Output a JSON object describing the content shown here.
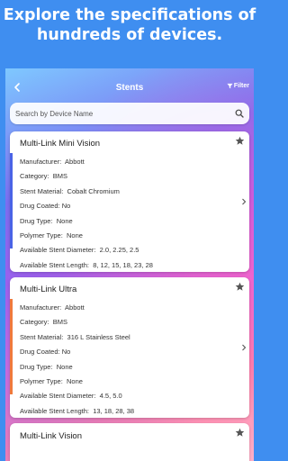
{
  "headline": "Explore the specifications of hundreds of devices.",
  "appbar": {
    "title": "Stents",
    "filter_label": "Filter"
  },
  "search": {
    "placeholder": "Search by Device Name"
  },
  "colors": {
    "background": "#3f8ef0",
    "accent_blue": "#4a63e6",
    "accent_orange": "#f07a3c"
  },
  "devices": [
    {
      "name": "Multi-Link Mini Vision",
      "fields": [
        {
          "label": "Manufacturer:",
          "value": "Abbott"
        },
        {
          "label": "Category:",
          "value": "BMS"
        },
        {
          "label": "Stent Material:",
          "value": "Cobalt Chromium"
        },
        {
          "label": "Drug Coated:",
          "value": "No"
        },
        {
          "label": "Drug Type:",
          "value": "None"
        },
        {
          "label": "Polymer Type:",
          "value": "None"
        },
        {
          "label": "Available Stent Diameter:",
          "value": "2.0, 2.25, 2.5"
        },
        {
          "label": "Available Stent Length:",
          "value": "8, 12, 15, 18, 23, 28"
        }
      ]
    },
    {
      "name": "Multi-Link Ultra",
      "fields": [
        {
          "label": "Manufacturer:",
          "value": "Abbott"
        },
        {
          "label": "Category:",
          "value": "BMS"
        },
        {
          "label": "Stent Material:",
          "value": "316 L Stainless Steel"
        },
        {
          "label": "Drug Coated:",
          "value": "No"
        },
        {
          "label": "Drug Type:",
          "value": "None"
        },
        {
          "label": "Polymer Type:",
          "value": "None"
        },
        {
          "label": "Available Stent Diameter:",
          "value": "4.5, 5.0"
        },
        {
          "label": "Available Stent Length:",
          "value": "13, 18, 28, 38"
        }
      ]
    },
    {
      "name": "Multi-Link Vision",
      "fields": []
    }
  ]
}
